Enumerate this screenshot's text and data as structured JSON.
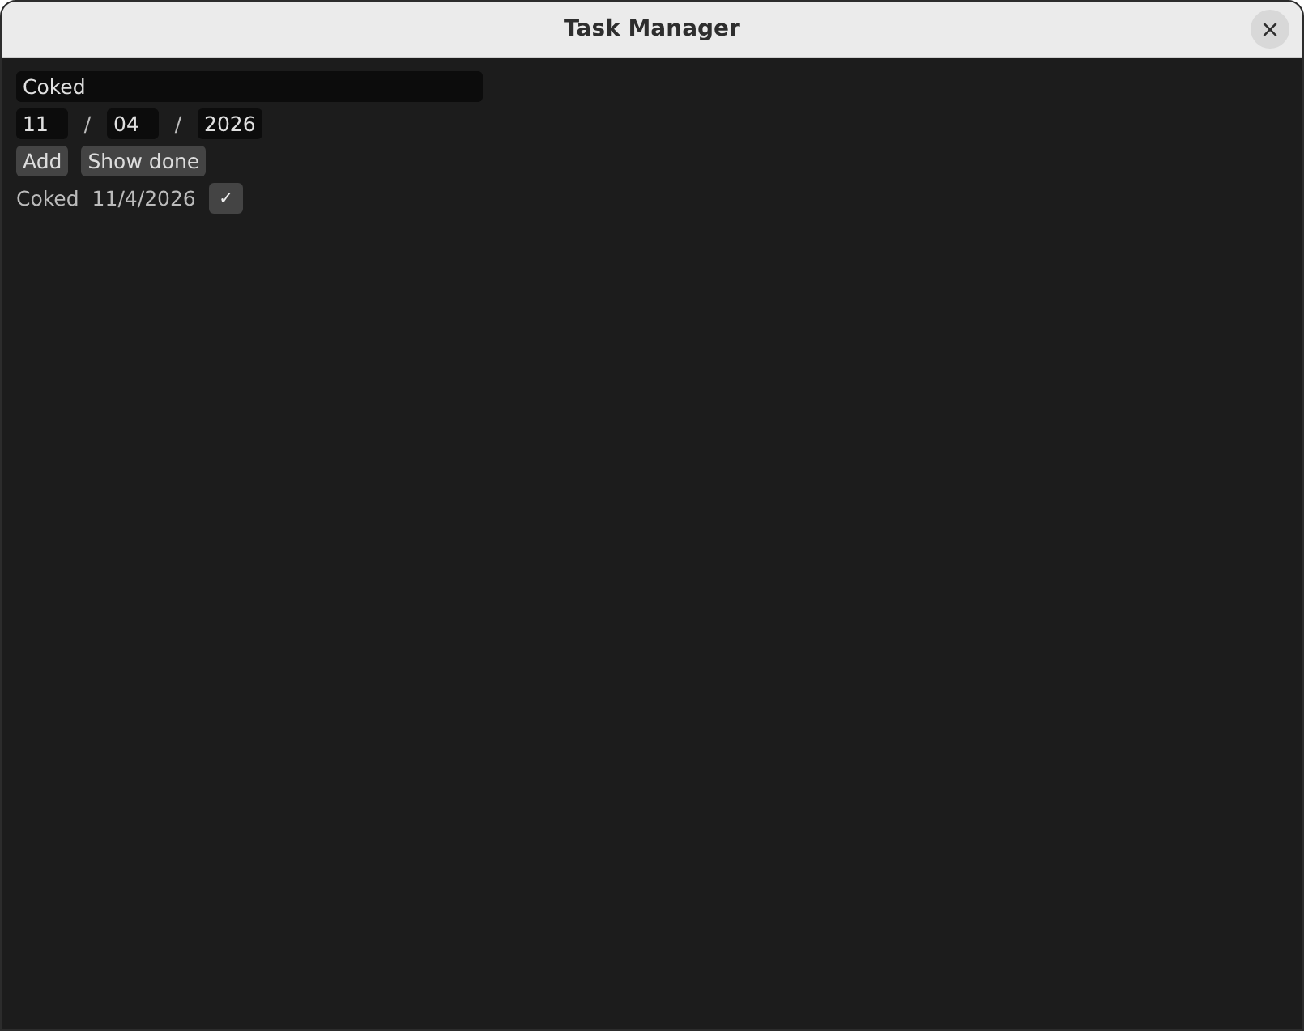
{
  "window": {
    "title": "Task Manager",
    "close": "×"
  },
  "task_field": {
    "value": "Coked"
  },
  "date_fields": [
    {
      "value": "11"
    },
    {
      "value": "04"
    },
    {
      "value": "2026"
    }
  ],
  "date_separator": "/",
  "buttons": [
    "Add",
    "Show done"
  ],
  "tasks": [
    {
      "name": "Coked",
      "date": "11/4/2026",
      "action": "✓"
    }
  ]
}
